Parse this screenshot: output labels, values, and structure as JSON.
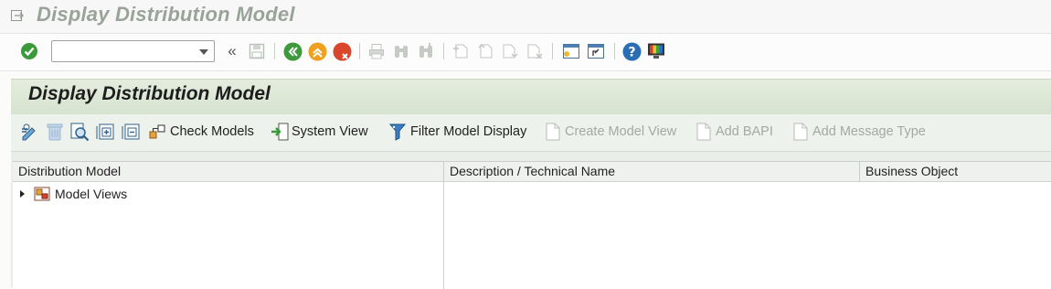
{
  "window": {
    "title": "Display Distribution Model"
  },
  "system_toolbar": {
    "command_field": {
      "value": "",
      "placeholder": ""
    },
    "icons": [
      "enter-icon",
      "save-icon",
      "back-icon",
      "exit-icon",
      "cancel-icon",
      "print-icon",
      "find-icon",
      "find-next-icon",
      "first-page-icon",
      "previous-page-icon",
      "next-page-icon",
      "last-page-icon",
      "create-session-icon",
      "create-shortcut-icon",
      "help-icon",
      "customize-layout-icon"
    ]
  },
  "screen": {
    "title": "Display Distribution Model",
    "app_toolbar": {
      "check_models": "Check Models",
      "system_view": "System View",
      "filter_model_display": "Filter Model Display",
      "create_model_view": "Create Model View",
      "add_bapi": "Add BAPI",
      "add_message_type": "Add Message Type"
    },
    "tree": {
      "columns": [
        "Distribution Model",
        "Description / Technical Name",
        "Business Object"
      ],
      "nodes": [
        {
          "label": "Model Views",
          "expanded": false
        }
      ]
    }
  },
  "colors": {
    "accent_green": "#2f8f2f",
    "back_green": "#3c9a3c",
    "exit_orange": "#f0a020",
    "cancel_red": "#d9462b",
    "help_blue": "#2a6fb5"
  }
}
